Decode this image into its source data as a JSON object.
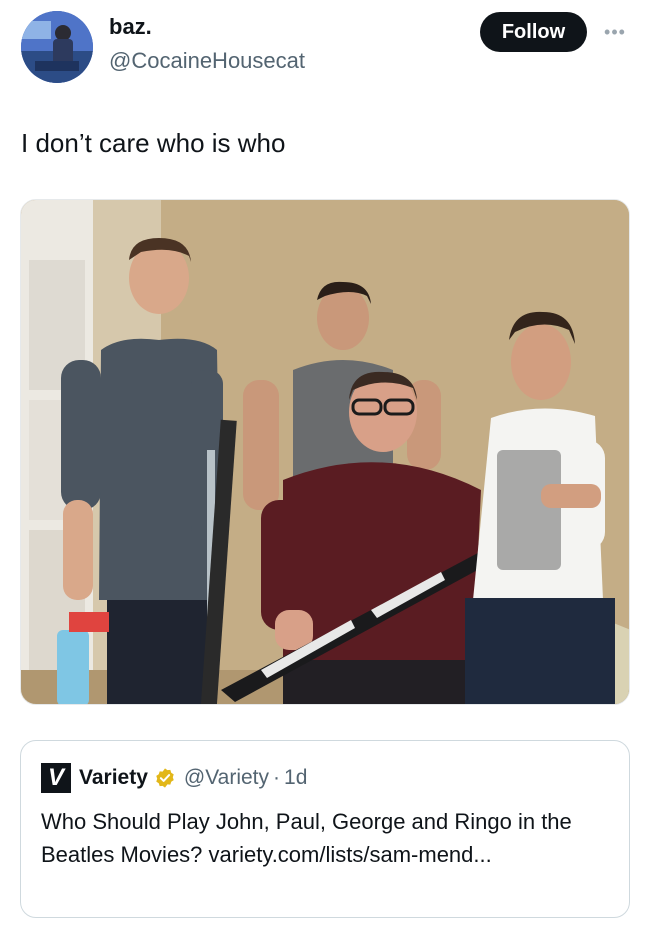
{
  "post": {
    "display_name": "baz.",
    "handle": "@CocaineHousecat",
    "follow_label": "Follow",
    "more_label": "•••",
    "text": "I don’t care who is who"
  },
  "quote": {
    "logo_letter": "V",
    "name": "Variety",
    "handle": "@Variety",
    "separator": "·",
    "time": "1d",
    "text": "Who Should Play John, Paul, George and Ringo in the Beatles Movies? variety.com/lists/sam-mend..."
  },
  "colors": {
    "follow_bg": "#0f1419",
    "handle_gray": "#536471",
    "verified_gold": "#e2b719",
    "border": "#cfd9de"
  },
  "icons": {
    "more": "more-horizontal-icon",
    "verified": "verified-gold-badge-icon"
  }
}
